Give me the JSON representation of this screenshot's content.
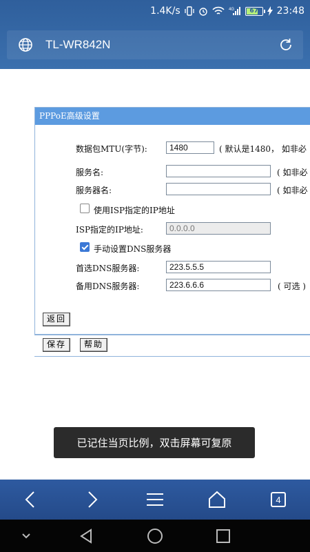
{
  "status_bar": {
    "speed": "1.4K/s",
    "signal_label": "4G",
    "battery": "67",
    "time": "23:48"
  },
  "browser": {
    "title": "TL-WR842N"
  },
  "panel": {
    "title": "PPPoE高级设置",
    "mtu_label": "数据包MTU(字节):",
    "mtu_value": "1480",
    "mtu_hint": "( 默认是1480， 如非必",
    "service_name_label": "服务名:",
    "service_name_value": "",
    "service_name_hint": "( 如非必",
    "server_name_label": "服务器名:",
    "server_name_value": "",
    "server_name_hint": "( 如非必",
    "use_isp_ip_label": "使用ISP指定的IP地址",
    "use_isp_ip_checked": false,
    "isp_ip_label": "ISP指定的IP地址:",
    "isp_ip_value": "0.0.0.0",
    "manual_dns_label": "手动设置DNS服务器",
    "manual_dns_checked": true,
    "primary_dns_label": "首选DNS服务器:",
    "primary_dns_value": "223.5.5.5",
    "secondary_dns_label": "备用DNS服务器:",
    "secondary_dns_value": "223.6.6.6",
    "secondary_dns_hint": "( 可选 )",
    "back_button": "返回",
    "save_button": "保存",
    "help_button": "帮助"
  },
  "toast": {
    "message": "已记住当页比例，双击屏幕可复原"
  },
  "navbar": {
    "tab_count": "4"
  },
  "colors": {
    "browser_bar": "#3b70ae",
    "panel_header": "#5c9be0",
    "nav_bar": "#2e5aa0",
    "toast_bg": "#2b2b2b"
  }
}
